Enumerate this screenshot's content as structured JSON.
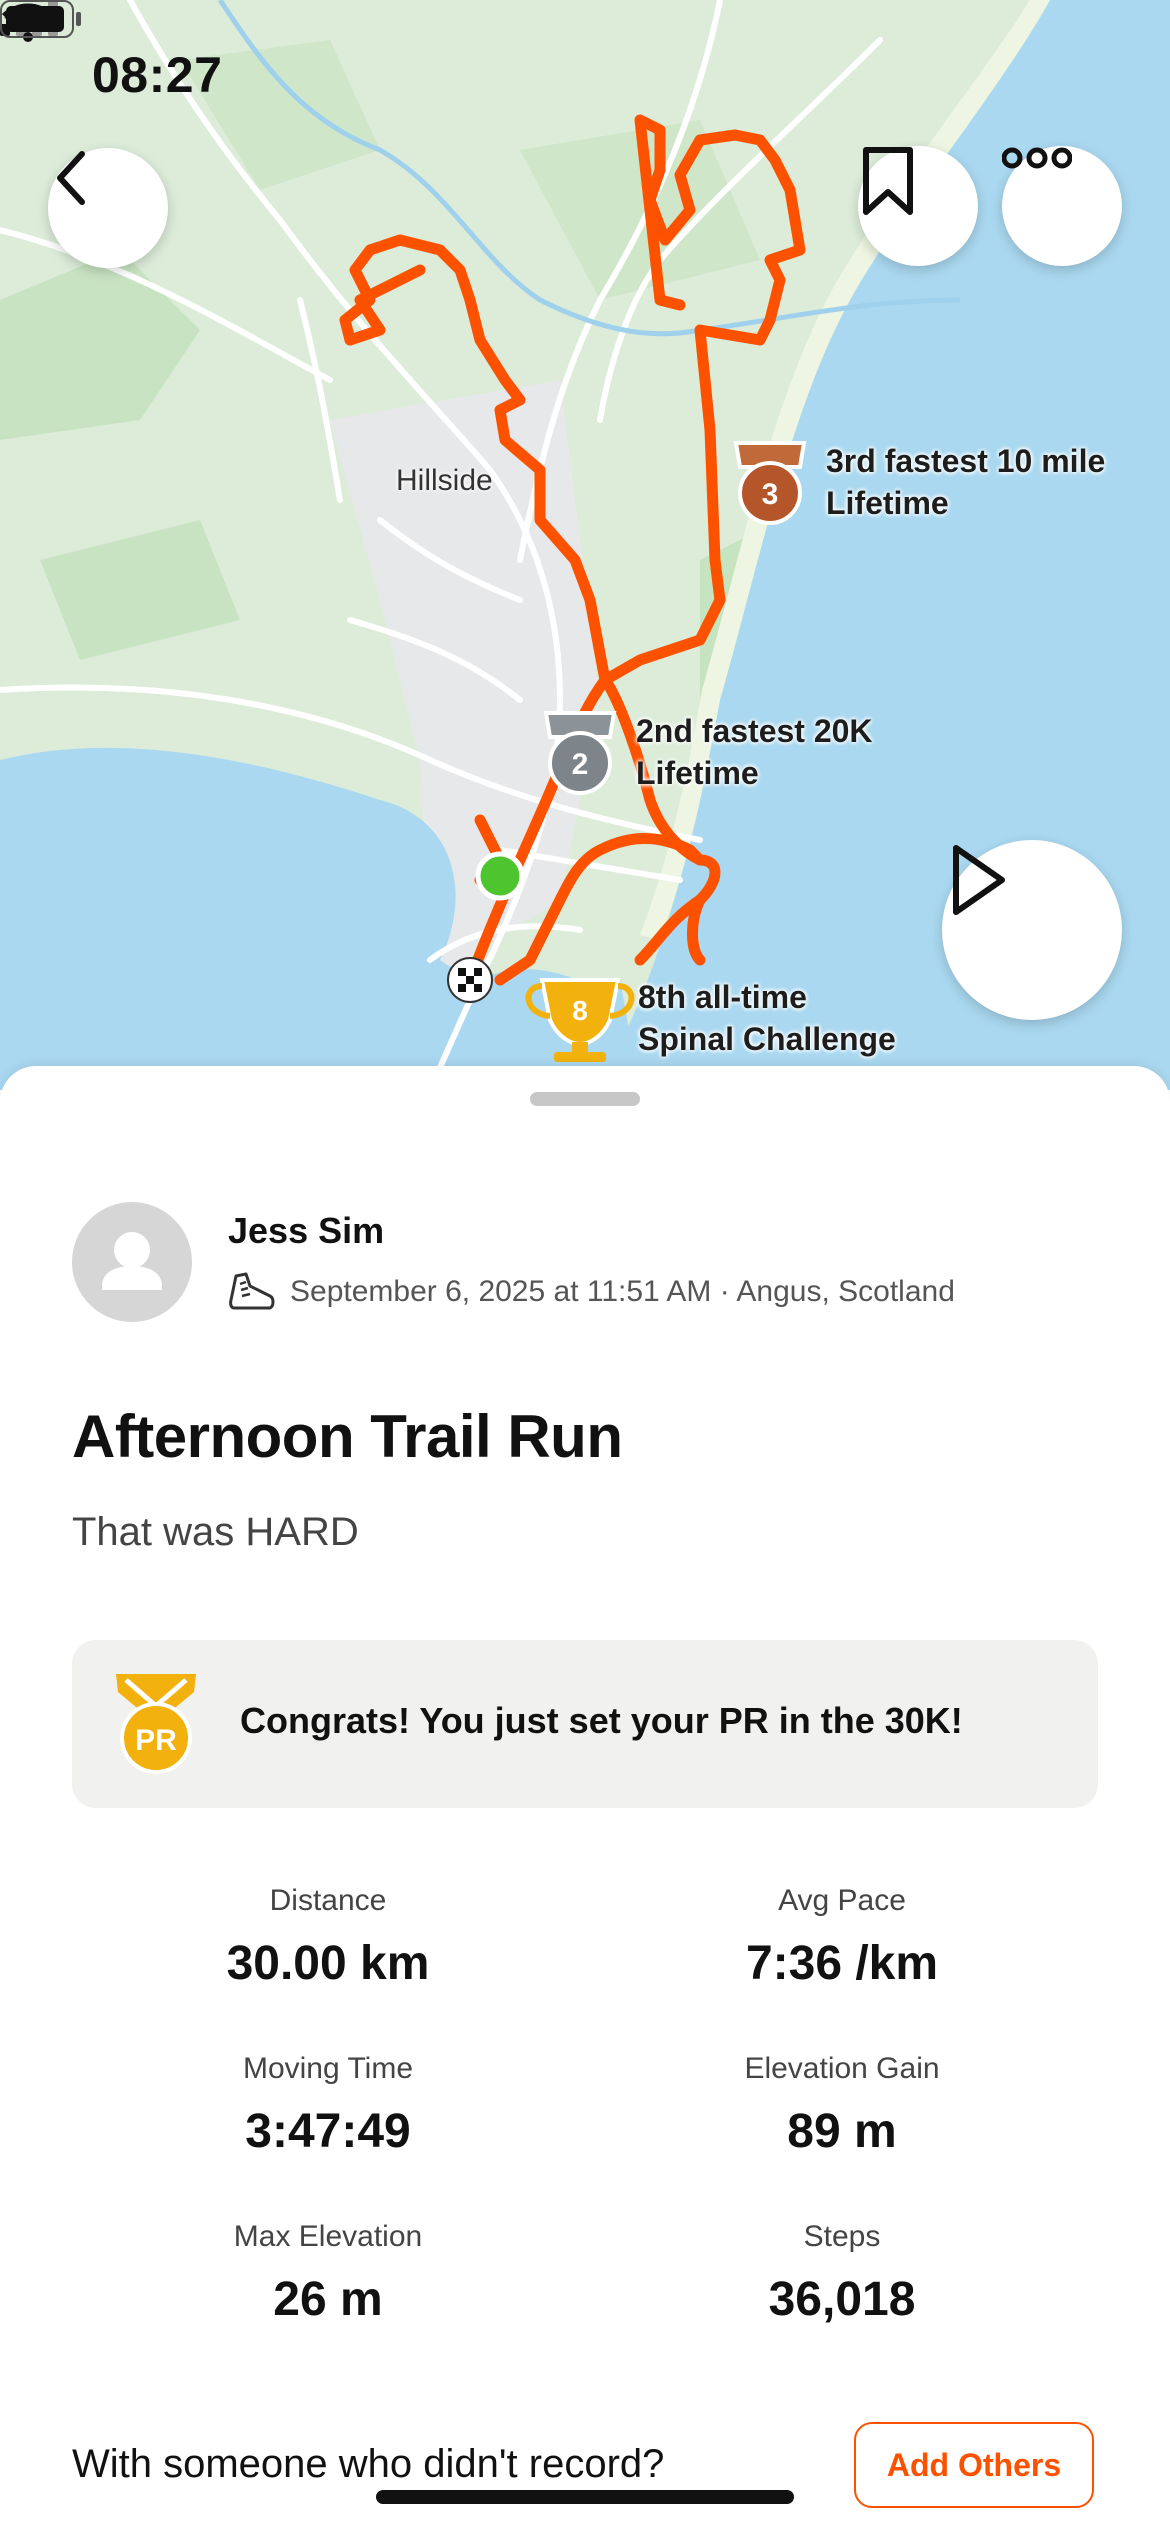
{
  "status_bar": {
    "time": "08:27"
  },
  "map": {
    "place_label": "Hillside",
    "achievements": [
      {
        "badge": "3",
        "line1": "3rd fastest 10 mile",
        "line2": "Lifetime",
        "type": "bronze-medal"
      },
      {
        "badge": "2",
        "line1": "2nd fastest 20K",
        "line2": "Lifetime",
        "type": "silver-medal"
      },
      {
        "badge": "8",
        "line1": "8th all-time",
        "line2": "Spinal Challenge",
        "type": "gold-trophy"
      }
    ]
  },
  "activity": {
    "athlete_name": "Jess Sim",
    "meta": "September 6, 2025 at 11:51 AM · Angus, Scotland",
    "title": "Afternoon Trail Run",
    "description": "That was HARD",
    "pr_badge": "PR",
    "pr_message": "Congrats! You just set your PR in the 30K!",
    "stats": [
      {
        "label": "Distance",
        "value": "30.00 km"
      },
      {
        "label": "Avg Pace",
        "value": "7:36 /km"
      },
      {
        "label": "Moving Time",
        "value": "3:47:49"
      },
      {
        "label": "Elevation Gain",
        "value": "89 m"
      },
      {
        "label": "Max Elevation",
        "value": "26 m"
      },
      {
        "label": "Steps",
        "value": "36,018"
      }
    ],
    "with_someone": "With someone who didn't record?",
    "add_others": "Add Others"
  },
  "colors": {
    "accent": "#fc5200",
    "route": "#fc5200",
    "water": "#a9d8f0",
    "land": "#dcecd9"
  }
}
